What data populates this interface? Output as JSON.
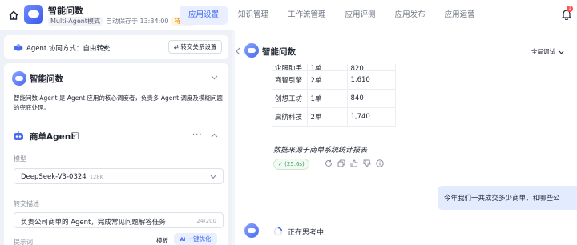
{
  "app": {
    "title": "智能问数",
    "mode": "Multi-Agent模式",
    "autosave": "自动保存于 13:34:00",
    "status": "待发布"
  },
  "tabs": [
    {
      "label": "应用设置",
      "active": true
    },
    {
      "label": "知识管理",
      "active": false
    },
    {
      "label": "工作流管理",
      "active": false
    },
    {
      "label": "应用评测",
      "active": false
    },
    {
      "label": "应用发布",
      "active": false
    },
    {
      "label": "应用运营",
      "active": false
    }
  ],
  "notifications": {
    "count": "1"
  },
  "left": {
    "collab_label": "Agent 协同方式：自由转交",
    "relation_button": "转交关系设置",
    "main_agent": {
      "name": "智能问数",
      "description": "智能问数 Agent 是 Agent 应用的核心调度者，负责多 Agent 调度及模糊问题的兜底处理。"
    },
    "sub_agent": {
      "name": "商单Agent",
      "more": "···",
      "model_label": "模型",
      "model_value": "DeepSeek-V3-0324",
      "model_tag": "128K",
      "transfer_label": "转交描述",
      "transfer_value": "负责公司商单的 Agent，完成常见问题解答任务",
      "transfer_count": "24/200",
      "prompt_label": "提示词",
      "template_button": "模板",
      "optimize_button": "一键优化"
    }
  },
  "chat": {
    "title": "智能问数",
    "debug_mode": "全局调试",
    "table_rows": [
      [
        "企服助手",
        "1单",
        "820"
      ],
      [
        "商智引擎",
        "2单",
        "1,610"
      ],
      [
        "创想工坊",
        "1单",
        "840"
      ],
      [
        "启航科技",
        "2单",
        "1,740"
      ]
    ],
    "source_note": "数据来源于商单系统统计报表",
    "timing": "(25.6s)",
    "user_message": "今年我们一共成交多少商单，和哪些公",
    "thinking": "正在思考中."
  },
  "colors": {
    "accent": "#3a66f1",
    "accent_bg": "#e9efff",
    "badge": "#e58a00",
    "success": "#3b9a56",
    "user_bubble": "#e3ecff"
  }
}
